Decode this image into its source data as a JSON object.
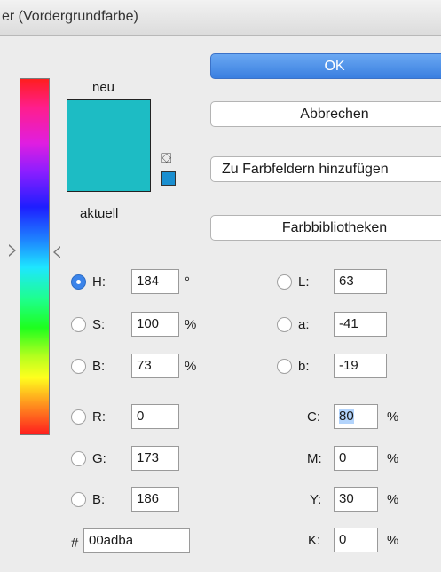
{
  "window": {
    "title": "er (Vordergrundfarbe)"
  },
  "preview": {
    "new_label": "neu",
    "current_label": "aktuell",
    "new_color": "#1dbcc4",
    "current_color": "#1dbcc4",
    "web_color": "#1a8fd0"
  },
  "buttons": {
    "ok": "OK",
    "cancel": "Abbrechen",
    "add_swatches": "Zu Farbfeldern hinzufügen",
    "libraries": "Farbbibliotheken"
  },
  "hsb": {
    "h": {
      "label": "H:",
      "value": "184",
      "unit": "°",
      "selected": true
    },
    "s": {
      "label": "S:",
      "value": "100",
      "unit": "%"
    },
    "b": {
      "label": "B:",
      "value": "73",
      "unit": "%"
    }
  },
  "rgb": {
    "r": {
      "label": "R:",
      "value": "0"
    },
    "g": {
      "label": "G:",
      "value": "173"
    },
    "b": {
      "label": "B:",
      "value": "186"
    }
  },
  "lab": {
    "l": {
      "label": "L:",
      "value": "63"
    },
    "a": {
      "label": "a:",
      "value": "-41"
    },
    "b": {
      "label": "b:",
      "value": "-19"
    }
  },
  "cmyk": {
    "c": {
      "label": "C:",
      "value": "80",
      "unit": "%"
    },
    "m": {
      "label": "M:",
      "value": "0",
      "unit": "%"
    },
    "y": {
      "label": "Y:",
      "value": "30",
      "unit": "%"
    },
    "k": {
      "label": "K:",
      "value": "0",
      "unit": "%"
    }
  },
  "hex": {
    "label": "#",
    "value": "00adba"
  }
}
